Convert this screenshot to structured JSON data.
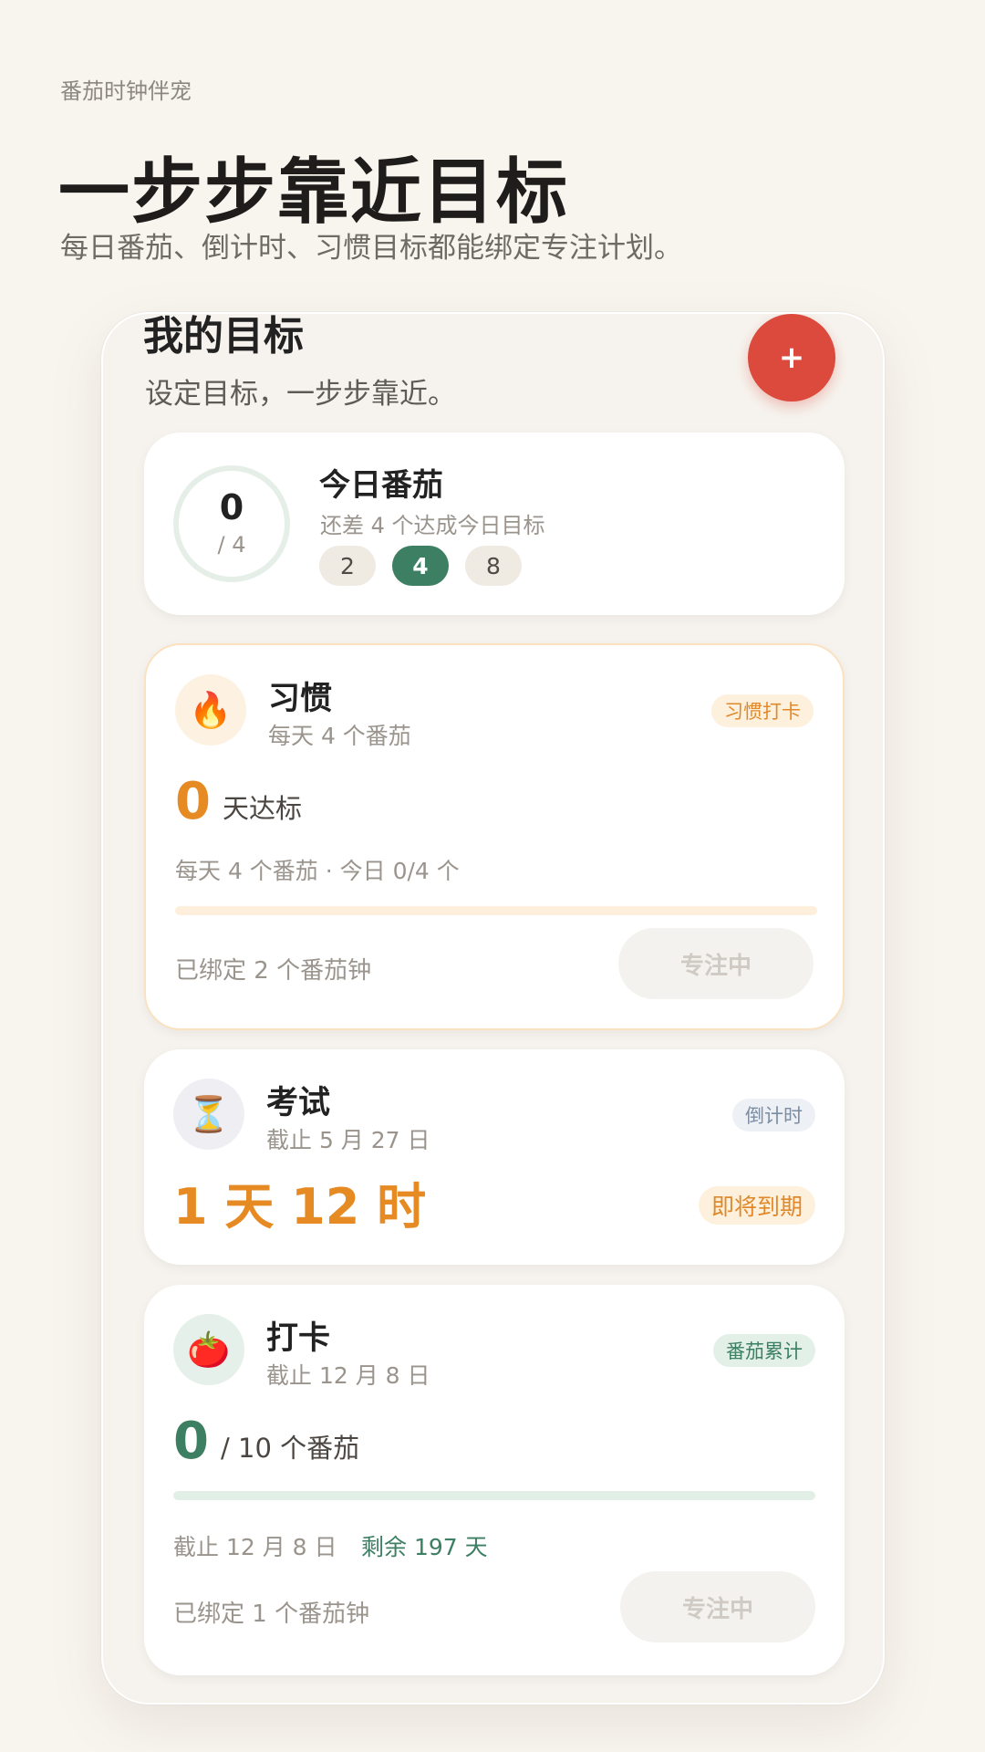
{
  "hero": {
    "kicker": "番茄时钟伴宠",
    "title": "一步步靠近目标",
    "subtitle": "每日番茄、倒计时、习惯目标都能绑定专注计划。"
  },
  "screen": {
    "title": "我的目标",
    "subtitle": "设定目标，一步步靠近。",
    "add_label": "+"
  },
  "today": {
    "count": "0",
    "total": "/ 4",
    "title": "今日番茄",
    "subtitle": "还差 4 个达成今日目标",
    "options": [
      "2",
      "4",
      "8"
    ],
    "selected": "4"
  },
  "habit": {
    "icon": "fire-icon",
    "emoji": "🔥",
    "title": "习惯",
    "subtitle": "每天 4 个番茄",
    "badge": "习惯打卡",
    "streak": "0",
    "streak_suffix": "天达标",
    "meta": "每天 4 个番茄 · 今日 0/4 个",
    "progress": 0,
    "bound": "已绑定 2 个番茄钟",
    "focus_label": "专注中"
  },
  "exam": {
    "icon": "hourglass-icon",
    "emoji": "⏳",
    "title": "考试",
    "subtitle": "截止 5 月 27 日",
    "badge": "倒计时",
    "countdown": "1 天 12 时",
    "status": "即将到期"
  },
  "checkin": {
    "icon": "tomato-icon",
    "emoji": "🍅",
    "title": "打卡",
    "subtitle": "截止 12 月 8 日",
    "badge": "番茄累计",
    "count": "0",
    "count_suffix": "/ 10 个番茄",
    "progress": 0,
    "deadline": "截止 12 月 8 日",
    "remaining": "剩余 197 天",
    "bound": "已绑定 1 个番茄钟",
    "focus_label": "专注中"
  },
  "colors": {
    "accent_red": "#db4a3c",
    "accent_green": "#3c7f62",
    "accent_orange": "#e68a24",
    "background": "#f8f5ef"
  }
}
